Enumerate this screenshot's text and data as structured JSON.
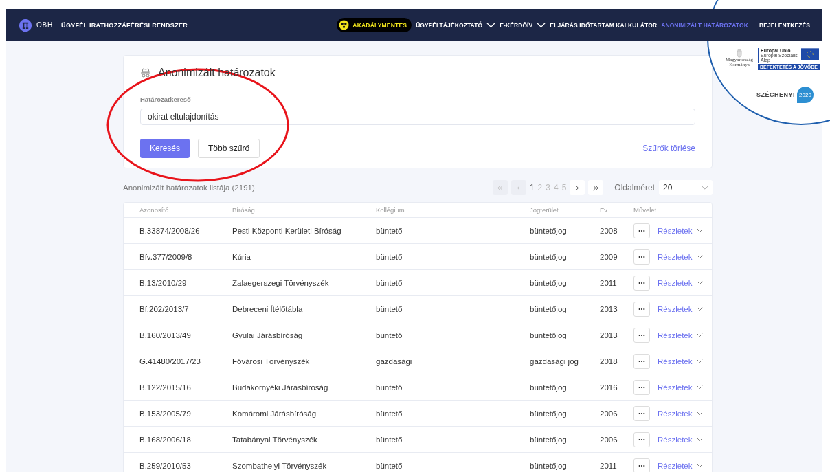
{
  "header": {
    "logo_text": "OBH",
    "system_title": "ÜGYFÉL IRATHOZZÁFÉRÉSI RENDSZER",
    "accessibility": "AKADÁLYMENTES",
    "nav": [
      {
        "label": "ÜGYFÉLTÁJÉKOZTATÓ",
        "dropdown": true,
        "selected": false
      },
      {
        "label": "E-KÉRDŐÍV",
        "dropdown": true,
        "selected": false
      },
      {
        "label": "ELJÁRÁS IDŐTARTAM KALKULÁTOR",
        "dropdown": false,
        "selected": false
      },
      {
        "label": "ANONIMIZÁLT HATÁROZATOK",
        "dropdown": false,
        "selected": true
      }
    ],
    "login": "BEJELENTKEZÉS"
  },
  "funding_badge": {
    "government": "Magyarország Kormánya",
    "eu_title": "Európai Unió",
    "eu_fund": "Európai Szociális Alap",
    "slogan": "BEFEKTETÉS A JÖVŐBE",
    "program": "SZÉCHENYI",
    "program_year": "2020"
  },
  "search_card": {
    "title": "Anonimizált határozatok",
    "field_label": "Határozatkereső",
    "field_value": "okirat eltulajdonítás",
    "search_button": "Keresés",
    "more_filters_button": "Több szűrő",
    "clear_filters": "Szűrők törlése"
  },
  "list": {
    "title": "Anonimizált határozatok listája (2191)",
    "pagination": {
      "pages": [
        {
          "label": "1",
          "selected": true
        },
        {
          "label": "2",
          "selected": false
        },
        {
          "label": "3",
          "selected": false
        },
        {
          "label": "4",
          "selected": false
        },
        {
          "label": "5",
          "selected": false
        }
      ],
      "first_disabled": true,
      "prev_disabled": true
    },
    "page_size_label": "Oldalméret",
    "page_size": "20",
    "columns": [
      "Azonosító",
      "Bíróság",
      "Kollégium",
      "Jogterület",
      "Év",
      "Művelet"
    ],
    "rows": [
      {
        "id": "B.33874/2008/26",
        "court": "Pesti Központi Kerületi Bíróság",
        "college": "büntető",
        "area": "büntetőjog",
        "year": "2008",
        "details": "Részletek"
      },
      {
        "id": "Bfv.377/2009/8",
        "court": "Kúria",
        "college": "büntető",
        "area": "büntetőjog",
        "year": "2009",
        "details": "Részletek"
      },
      {
        "id": "B.13/2010/29",
        "court": "Zalaegerszegi Törvényszék",
        "college": "büntető",
        "area": "büntetőjog",
        "year": "2011",
        "details": "Részletek"
      },
      {
        "id": "Bf.202/2013/7",
        "court": "Debreceni Ítélőtábla",
        "college": "büntető",
        "area": "büntetőjog",
        "year": "2013",
        "details": "Részletek"
      },
      {
        "id": "B.160/2013/49",
        "court": "Gyulai Járásbíróság",
        "college": "büntető",
        "area": "büntetőjog",
        "year": "2013",
        "details": "Részletek"
      },
      {
        "id": "G.41480/2017/23",
        "court": "Fővárosi Törvényszék",
        "college": "gazdasági",
        "area": "gazdasági jog",
        "year": "2018",
        "details": "Részletek"
      },
      {
        "id": "B.122/2015/16",
        "court": "Budakörnyéki Járásbíróság",
        "college": "büntető",
        "area": "büntetőjog",
        "year": "2016",
        "details": "Részletek"
      },
      {
        "id": "B.153/2005/79",
        "court": "Komáromi Járásbíróság",
        "college": "büntető",
        "area": "büntetőjog",
        "year": "2006",
        "details": "Részletek"
      },
      {
        "id": "B.168/2006/18",
        "court": "Tatabányai Törvényszék",
        "college": "büntető",
        "area": "büntetőjog",
        "year": "2006",
        "details": "Részletek"
      },
      {
        "id": "B.259/2010/53",
        "court": "Szombathelyi Törvényszék",
        "college": "büntető",
        "area": "büntetőjog",
        "year": "2011",
        "details": "Részletek"
      }
    ]
  }
}
